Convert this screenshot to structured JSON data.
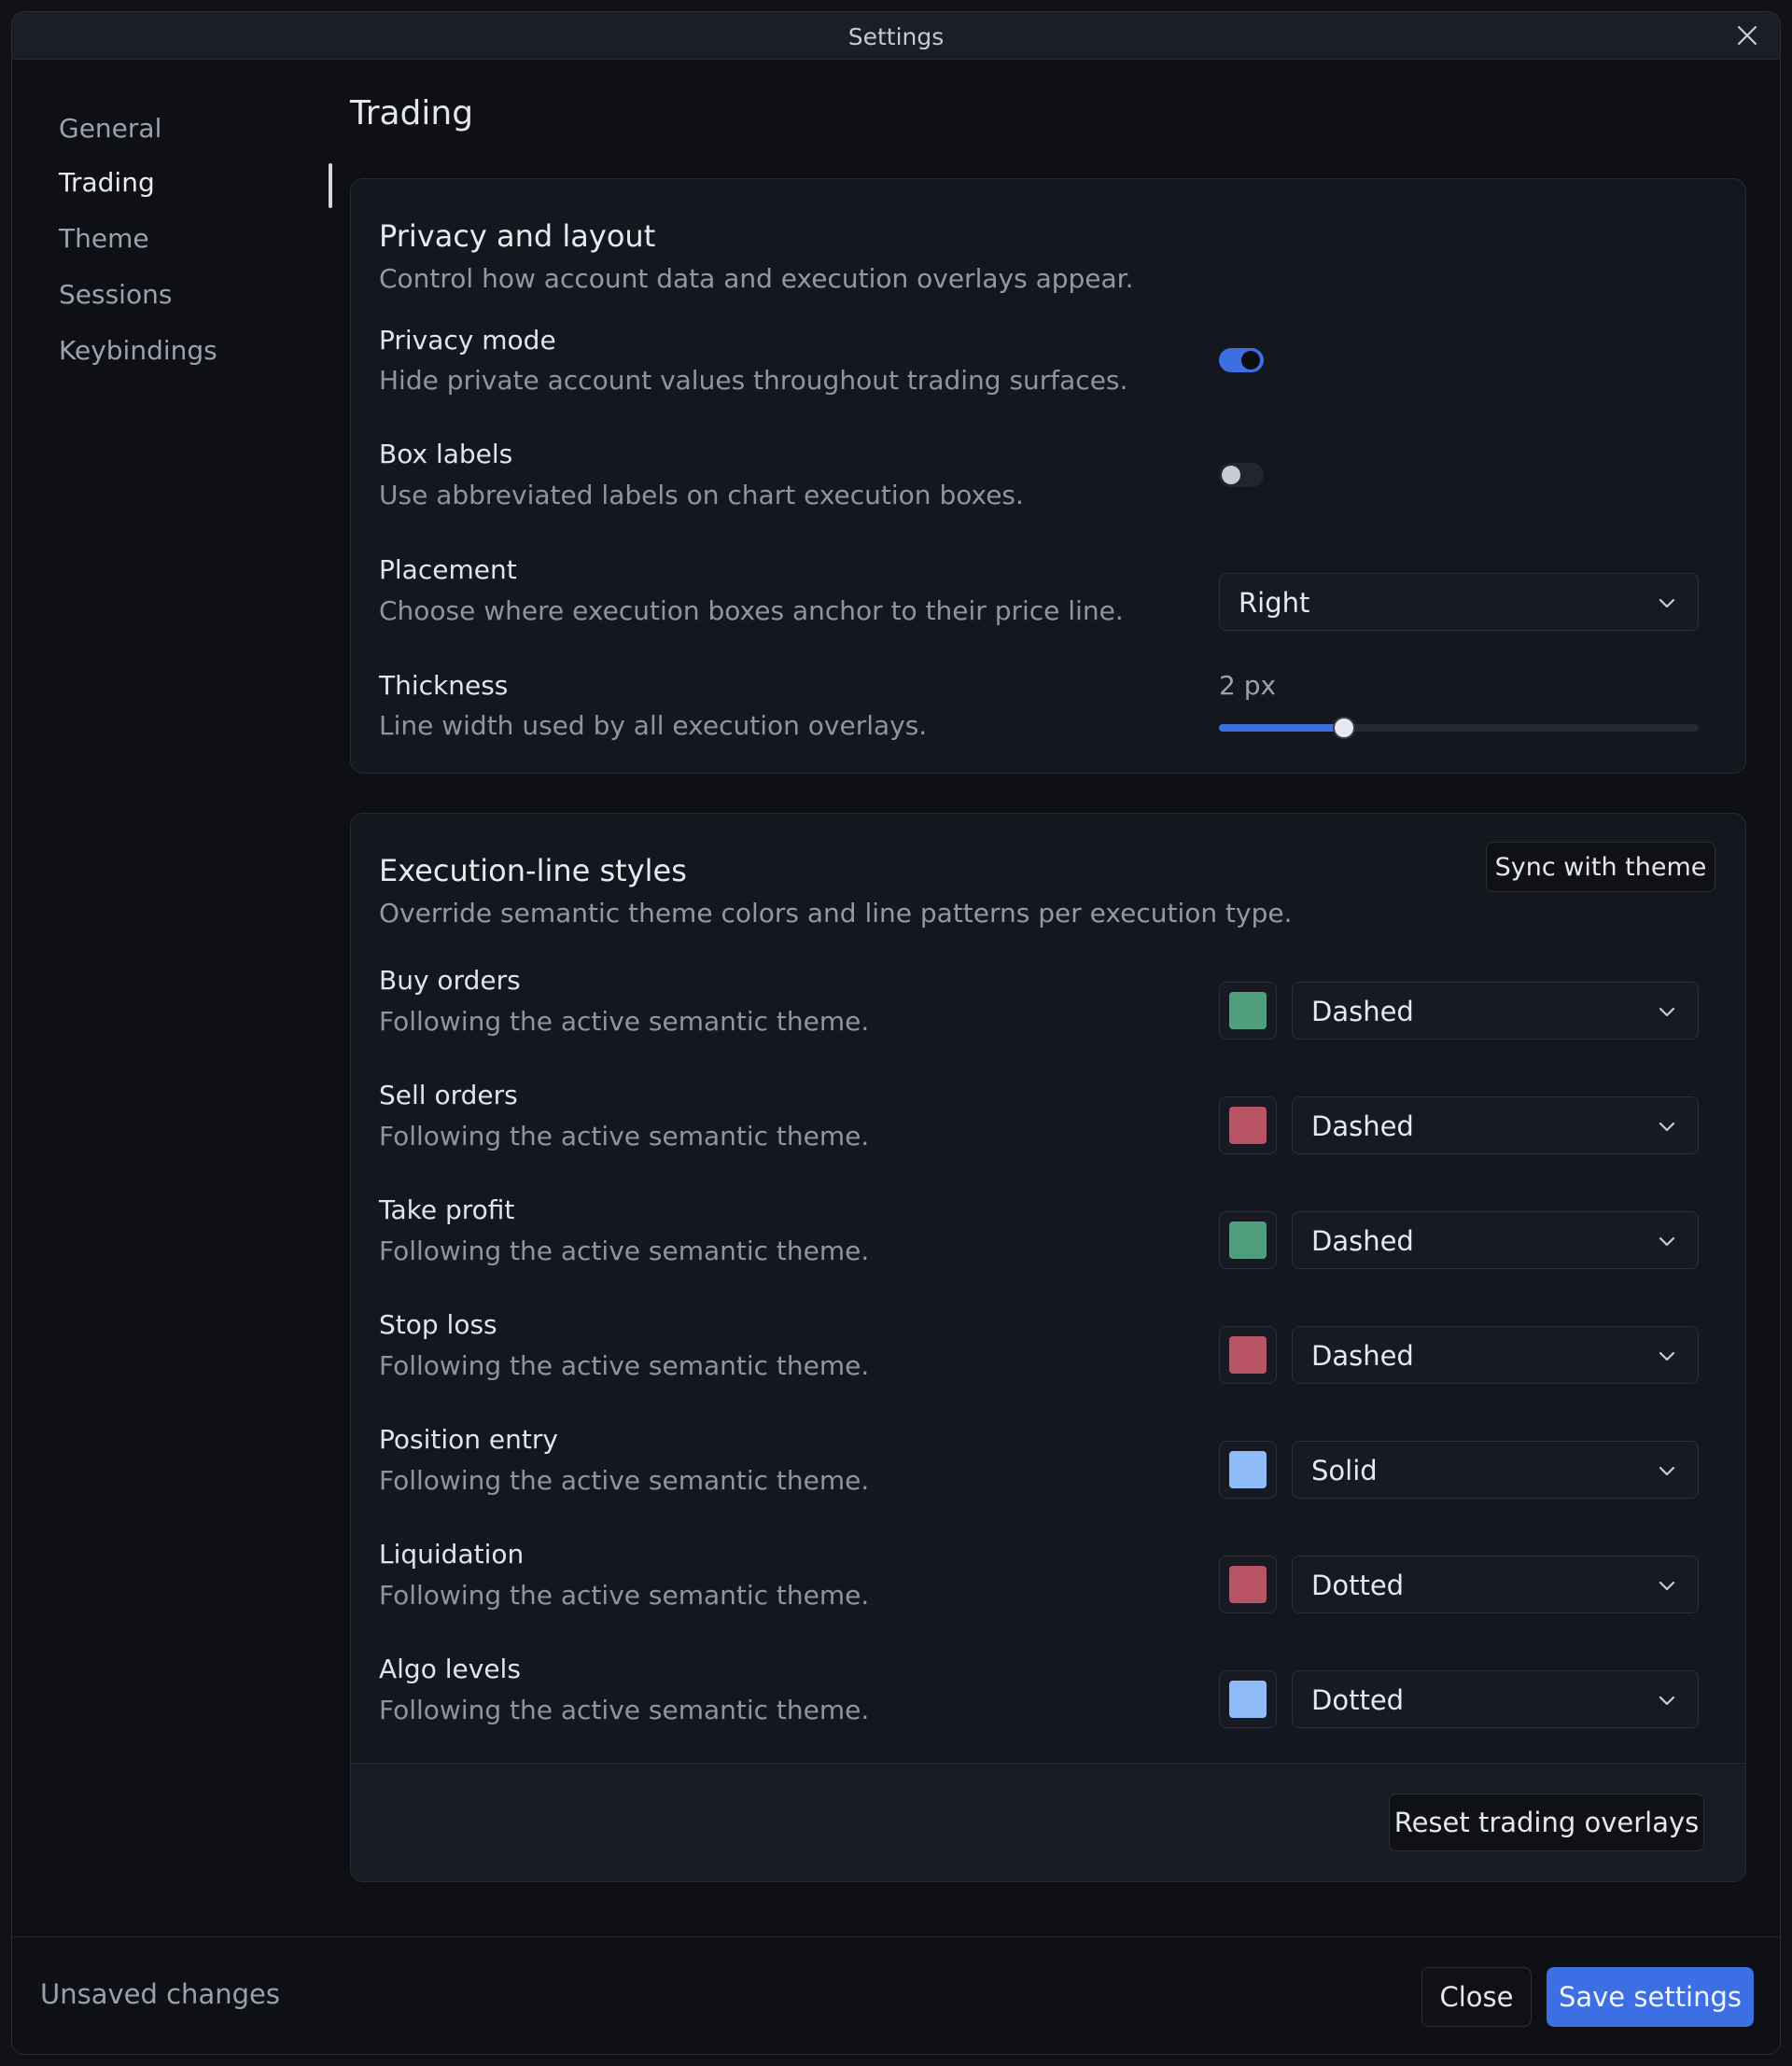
{
  "window": {
    "title": "Settings"
  },
  "sidebar": {
    "items": [
      {
        "label": "General"
      },
      {
        "label": "Trading"
      },
      {
        "label": "Theme"
      },
      {
        "label": "Sessions"
      },
      {
        "label": "Keybindings"
      }
    ],
    "active_index": 1
  },
  "page": {
    "title": "Trading"
  },
  "privacy": {
    "title": "Privacy and layout",
    "description": "Control how account data and execution overlays appear.",
    "privacy_mode": {
      "title": "Privacy mode",
      "description": "Hide private account values throughout trading surfaces.",
      "enabled": true
    },
    "box_labels": {
      "title": "Box labels",
      "description": "Use abbreviated labels on chart execution boxes.",
      "enabled": false
    },
    "placement": {
      "title": "Placement",
      "description": "Choose where execution boxes anchor to their price line.",
      "value": "Right"
    },
    "thickness": {
      "title": "Thickness",
      "description": "Line width used by all execution overlays.",
      "value_label": "2 px",
      "fraction": 0.26
    }
  },
  "styles": {
    "title": "Execution-line styles",
    "description": "Override semantic theme colors and line patterns per execution type.",
    "sync_label": "Sync with theme",
    "reset_label": "Reset trading overlays",
    "rows": [
      {
        "title": "Buy orders",
        "description": "Following the active semantic theme.",
        "color": "#4f9e7c",
        "pattern": "Dashed"
      },
      {
        "title": "Sell orders",
        "description": "Following the active semantic theme.",
        "color": "#b85463",
        "pattern": "Dashed"
      },
      {
        "title": "Take profit",
        "description": "Following the active semantic theme.",
        "color": "#4f9e7c",
        "pattern": "Dashed"
      },
      {
        "title": "Stop loss",
        "description": "Following the active semantic theme.",
        "color": "#b85463",
        "pattern": "Dashed"
      },
      {
        "title": "Position entry",
        "description": "Following the active semantic theme.",
        "color": "#8fbcf7",
        "pattern": "Solid"
      },
      {
        "title": "Liquidation",
        "description": "Following the active semantic theme.",
        "color": "#b85463",
        "pattern": "Dotted"
      },
      {
        "title": "Algo levels",
        "description": "Following the active semantic theme.",
        "color": "#8fbcf7",
        "pattern": "Dotted"
      }
    ]
  },
  "footer": {
    "status": "Unsaved changes",
    "close_label": "Close",
    "save_label": "Save settings"
  },
  "colors": {
    "accent": "#3b6fe3"
  },
  "icons": {
    "close": "close-icon",
    "chevron": "chevron-down-icon"
  }
}
